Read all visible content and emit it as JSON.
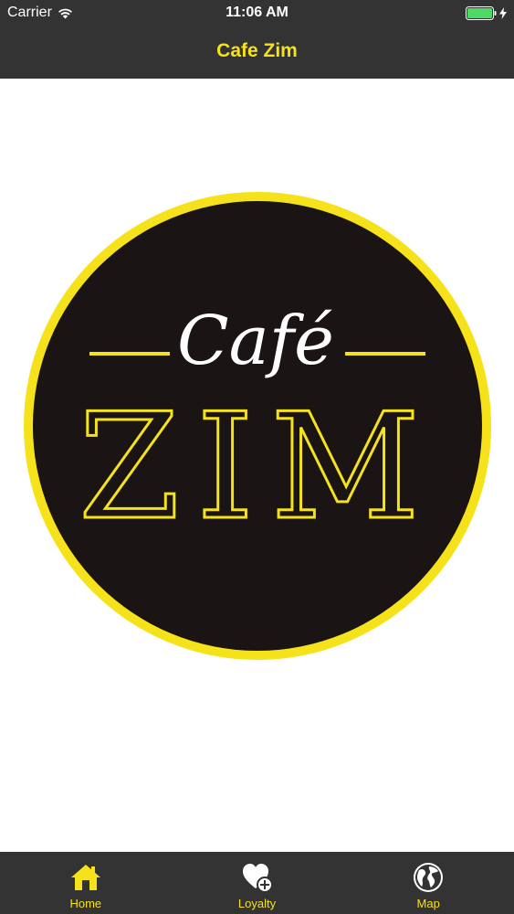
{
  "status_bar": {
    "carrier": "Carrier",
    "time": "11:06 AM",
    "battery_level": 1.0
  },
  "nav": {
    "title": "Cafe Zim"
  },
  "logo": {
    "line1": "Café",
    "line2": "ZIM"
  },
  "tabs": [
    {
      "label": "Home",
      "icon": "home-icon",
      "selected": true
    },
    {
      "label": "Loyalty",
      "icon": "heart-plus-icon",
      "selected": false
    },
    {
      "label": "Map",
      "icon": "globe-icon",
      "selected": false
    }
  ],
  "colors": {
    "bar_background": "#333333",
    "accent": "#f5e21a",
    "logo_fill": "#1a1414",
    "tab_inactive": "#ffffff",
    "battery": "#4cd964"
  }
}
